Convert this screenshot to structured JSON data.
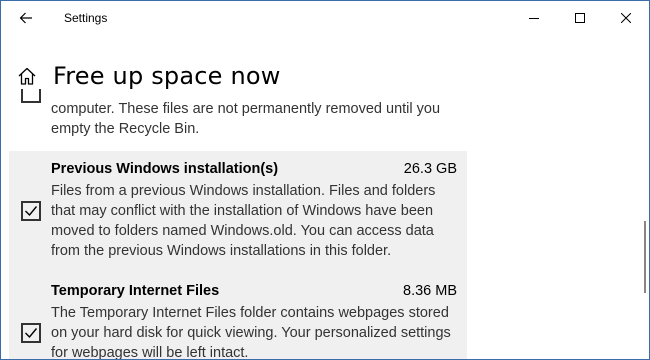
{
  "window": {
    "title": "Settings",
    "controls": {
      "minimize": "minimize",
      "maximize": "maximize",
      "close": "close"
    }
  },
  "page": {
    "title": "Free up space now"
  },
  "items": [
    {
      "name": "",
      "size": "",
      "checked": false,
      "description": "computer. These files are not permanently removed until you empty the Recycle Bin."
    },
    {
      "name": "Previous Windows installation(s)",
      "size": "26.3 GB",
      "checked": true,
      "description": "Files from a previous Windows installation.  Files and folders that may conflict with the installation of Windows have been moved to folders named Windows.old.  You can access data from the previous Windows installations in this folder."
    },
    {
      "name": "Temporary Internet Files",
      "size": "8.36 MB",
      "checked": true,
      "description": "The Temporary Internet Files folder contains webpages stored on your hard disk for quick viewing. Your personalized settings for webpages will be left intact."
    }
  ],
  "icons": {
    "back": "back-arrow-icon",
    "home": "home-icon",
    "check": "checkmark-icon"
  },
  "colors": {
    "window_border": "#3b6ea8",
    "selected_bg": "#f0f0f0",
    "scroll_thumb": "#868686"
  }
}
